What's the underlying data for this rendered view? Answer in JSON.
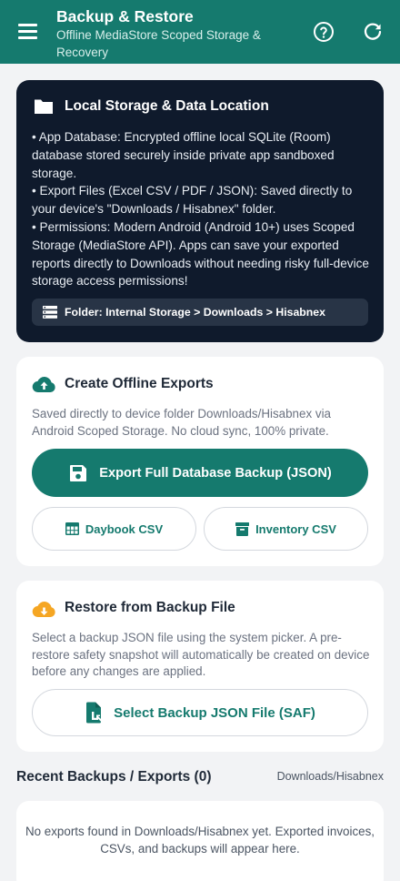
{
  "app_bar": {
    "title": "Backup & Restore",
    "subtitle": "Offline MediaStore Scoped Storage & Recovery",
    "menu_icon": "hamburger-menu-icon",
    "help_icon": "help-circle-icon",
    "refresh_icon": "refresh-icon",
    "background_color": "#157a6e"
  },
  "storage_info": {
    "title": "Local Storage & Data Location",
    "icon": "folder-icon",
    "bullets": [
      "• App Database: Encrypted offline local SQLite (Room) database stored securely inside private app sandboxed storage.",
      "• Export Files (Excel CSV / PDF / JSON): Saved directly to your device's \"Downloads / Hisabnex\" folder.",
      "• Permissions: Modern Android (Android 10+) uses Scoped Storage (MediaStore API). Apps can save your exported reports directly to Downloads without needing risky full-device storage access permissions!"
    ],
    "folder_path": "Folder: Internal Storage > Downloads > Hisabnex",
    "background_color": "#0f1a2c"
  },
  "exports": {
    "title": "Create Offline Exports",
    "icon": "cloud-upload-icon",
    "description": "Saved directly to device folder Downloads/Hisabnex via Android Scoped Storage. No cloud sync, 100% private.",
    "full_backup_label": "Export Full Database Backup (JSON)",
    "daybook_label": "Daybook CSV",
    "inventory_label": "Inventory CSV"
  },
  "restore": {
    "title": "Restore from Backup File",
    "icon": "download-circle-icon",
    "description": "Select a backup JSON file using the system picker. A pre-restore safety snapshot will automatically be created on device before any changes are applied.",
    "select_label": "Select Backup JSON File (SAF)",
    "accent_color": "#f5a623"
  },
  "recent": {
    "title": "Recent Backups / Exports (0)",
    "path": "Downloads/Hisabnex",
    "empty_message": "No exports found in Downloads/Hisabnex yet. Exported invoices, CSVs, and backups will appear here."
  }
}
